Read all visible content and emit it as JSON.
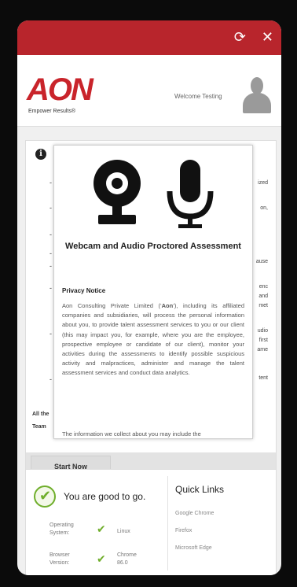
{
  "topbar": {
    "color": "#b8252c",
    "refresh_icon": "refresh-icon",
    "close_icon": "close-icon"
  },
  "header": {
    "logo": "AON",
    "tagline": "Empower Results®",
    "welcome": "Welcome Testing"
  },
  "main": {
    "bullet_symbol": "-",
    "right_fragments": [
      "ized",
      "on,",
      "ause",
      "enc",
      "and",
      "met",
      "udio",
      "first",
      "ame",
      "tent"
    ],
    "footer_fragments": [
      "All the",
      "Team"
    ],
    "start_button": "Start Now"
  },
  "modal": {
    "title": "Webcam and Audio Proctored Assessment",
    "privacy_heading": "Privacy Notice",
    "privacy_intro": "Aon Consulting Private Limited (‘",
    "privacy_bold": "Aon",
    "privacy_rest": "’), including its affiliated companies and subsidiaries, will process the personal information about you, to provide talent assessment services to you or our client (this may impact you, for example, where you are the employee, prospective employee or candidate of our client), monitor your activities during the assessments to identify possible suspicious activity and malpractices, administer and manage the talent assessment services and conduct data analytics.",
    "privacy_more": "The information we collect about you may include the"
  },
  "status": {
    "good_text": "You are good to go.",
    "rows": [
      {
        "label": "Operating System:",
        "value": "Linux"
      },
      {
        "label": "Browser Version:",
        "value": "Chrome 86.0"
      }
    ],
    "check_color": "#6fae2b"
  },
  "quick_links": {
    "title": "Quick Links",
    "links": [
      "Google Chrome",
      "Firefox",
      "Microsoft Edge"
    ]
  }
}
